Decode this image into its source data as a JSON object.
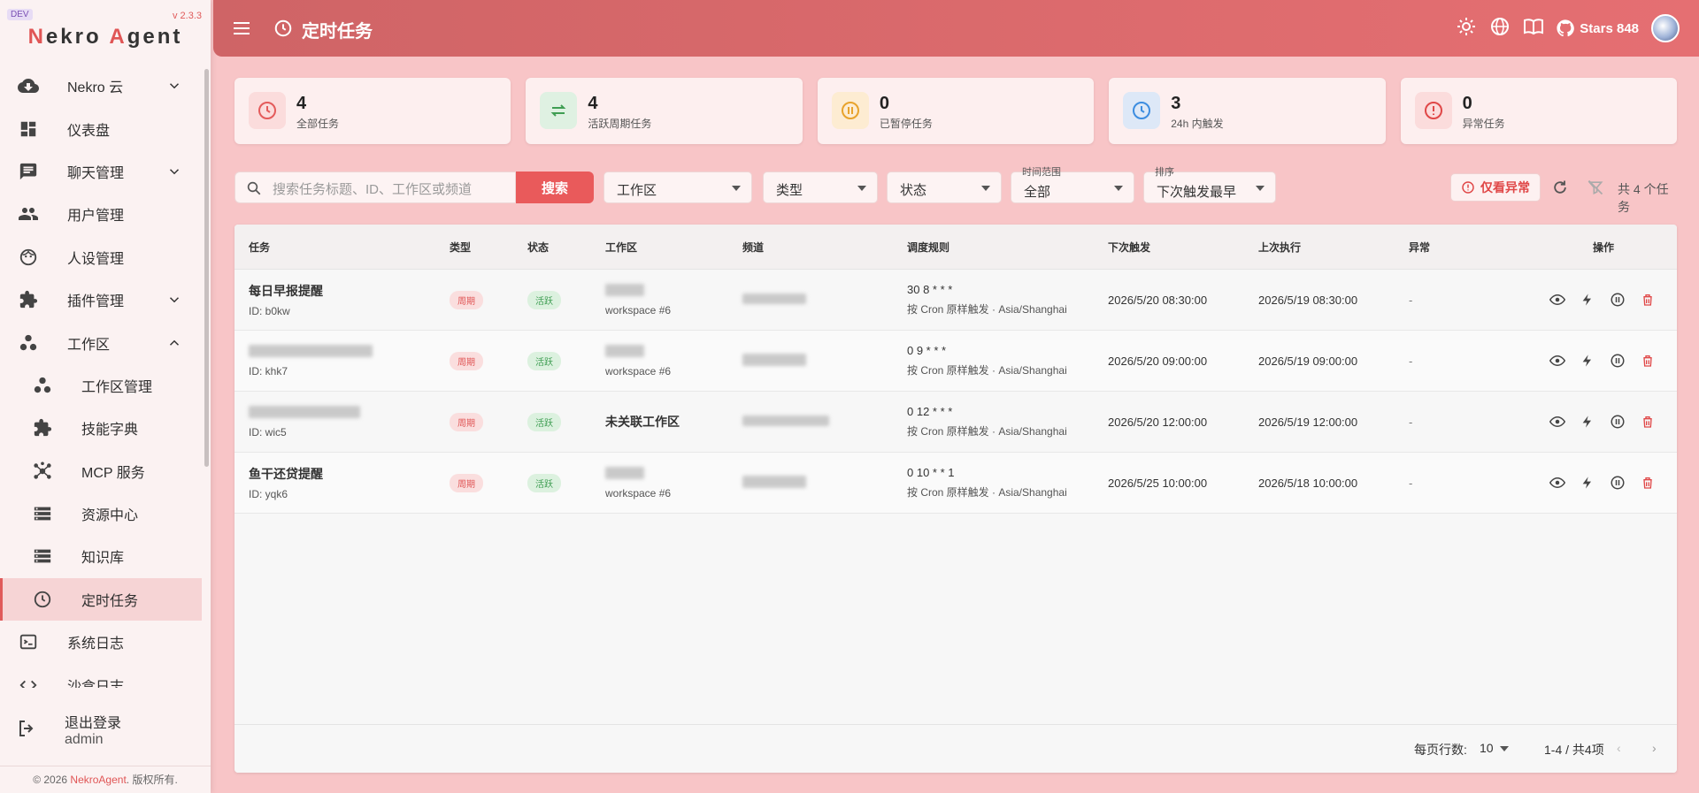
{
  "sidebar": {
    "dev_badge": "DEV",
    "version": "v 2.3.3",
    "logo": {
      "n": "N",
      "ekro": "ekro ",
      "a": "A",
      "gent": "gent"
    },
    "items": [
      {
        "label": "Nekro 云",
        "icon": "cloud-download-icon",
        "chevron": "down"
      },
      {
        "label": "仪表盘",
        "icon": "dashboard-icon"
      },
      {
        "label": "聊天管理",
        "icon": "chat-icon",
        "chevron": "down"
      },
      {
        "label": "用户管理",
        "icon": "users-icon"
      },
      {
        "label": "人设管理",
        "icon": "face-icon"
      },
      {
        "label": "插件管理",
        "icon": "puzzle-icon",
        "chevron": "down"
      },
      {
        "label": "工作区",
        "icon": "workspace-icon",
        "chevron": "up"
      },
      {
        "label": "工作区管理",
        "icon": "workspace-icon",
        "sub": true
      },
      {
        "label": "技能字典",
        "icon": "puzzle-icon",
        "sub": true
      },
      {
        "label": "MCP 服务",
        "icon": "hub-icon",
        "sub": true
      },
      {
        "label": "资源中心",
        "icon": "storage-icon",
        "sub": true
      },
      {
        "label": "知识库",
        "icon": "storage-icon",
        "sub": true
      },
      {
        "label": "定时任务",
        "icon": "clock-icon",
        "sub": true,
        "active": true
      },
      {
        "label": "系统日志",
        "icon": "terminal-icon"
      },
      {
        "label": "沙盒日志",
        "icon": "code-icon"
      }
    ],
    "logout": {
      "label": "退出登录",
      "user": "admin"
    },
    "footer": {
      "prefix": "© 2026 ",
      "link": "NekroAgent",
      "suffix": ". 版权所有."
    }
  },
  "topbar": {
    "title": "定时任务",
    "stars_label": "Stars 848"
  },
  "stats": [
    {
      "value": "4",
      "label": "全部任务",
      "icon": "clock-icon",
      "color": "#e45b5b",
      "bg": "#fbdcdc"
    },
    {
      "value": "4",
      "label": "活跃周期任务",
      "icon": "repeat-icon",
      "color": "#3f9e53",
      "bg": "#dff1e2"
    },
    {
      "value": "0",
      "label": "已暂停任务",
      "icon": "pause-icon",
      "color": "#e8a32c",
      "bg": "#fdecd2"
    },
    {
      "value": "3",
      "label": "24h 内触发",
      "icon": "clock-icon",
      "color": "#3d8de0",
      "bg": "#dde8f7"
    },
    {
      "value": "0",
      "label": "异常任务",
      "icon": "alert-icon",
      "color": "#e04848",
      "bg": "#fbdcdc"
    }
  ],
  "filters": {
    "search_placeholder": "搜索任务标题、ID、工作区或频道",
    "search_button": "搜索",
    "workspace": "工作区",
    "type": "类型",
    "status": "状态",
    "time_caption": "时间范围",
    "time_value": "全部",
    "sort_caption": "排序",
    "sort_value": "下次触发最早",
    "only_errors": "仅看异常",
    "total": "共 4 个任务"
  },
  "table": {
    "headers": [
      "任务",
      "类型",
      "状态",
      "工作区",
      "频道",
      "调度规则",
      "下次触发",
      "上次执行",
      "异常",
      "操作"
    ],
    "rows": [
      {
        "title": "每日早报提醒",
        "id": "ID: b0kw",
        "type": "周期",
        "status": "活跃",
        "workspace": "workspace #6",
        "rule": "30 8 * * *",
        "rule_desc": "按 Cron 原样触发 · Asia/Shanghai",
        "next": "2026/5/20 08:30:00",
        "last": "2026/5/19 08:30:00",
        "error": "-"
      },
      {
        "title": "",
        "id": "ID: khk7",
        "type": "周期",
        "status": "活跃",
        "workspace": "workspace #6",
        "rule": "0 9 * * *",
        "rule_desc": "按 Cron 原样触发 · Asia/Shanghai",
        "next": "2026/5/20 09:00:00",
        "last": "2026/5/19 09:00:00",
        "error": "-"
      },
      {
        "title": "",
        "id": "ID: wic5",
        "type": "周期",
        "status": "活跃",
        "workspace_title": "未关联工作区",
        "rule": "0 12 * * *",
        "rule_desc": "按 Cron 原样触发 · Asia/Shanghai",
        "next": "2026/5/20 12:00:00",
        "last": "2026/5/19 12:00:00",
        "error": "-"
      },
      {
        "title": "鱼干还贷提醒",
        "id": "ID: yqk6",
        "type": "周期",
        "status": "活跃",
        "workspace": "workspace #6",
        "rule": "0 10 * * 1",
        "rule_desc": "按 Cron 原样触发 · Asia/Shanghai",
        "next": "2026/5/25 10:00:00",
        "last": "2026/5/18 10:00:00",
        "error": "-"
      }
    ],
    "footer": {
      "rows_per_page_label": "每页行数:",
      "rows_per_page": "10",
      "range": "1-4 / 共4项",
      "prev": "‹",
      "next": "›"
    }
  }
}
